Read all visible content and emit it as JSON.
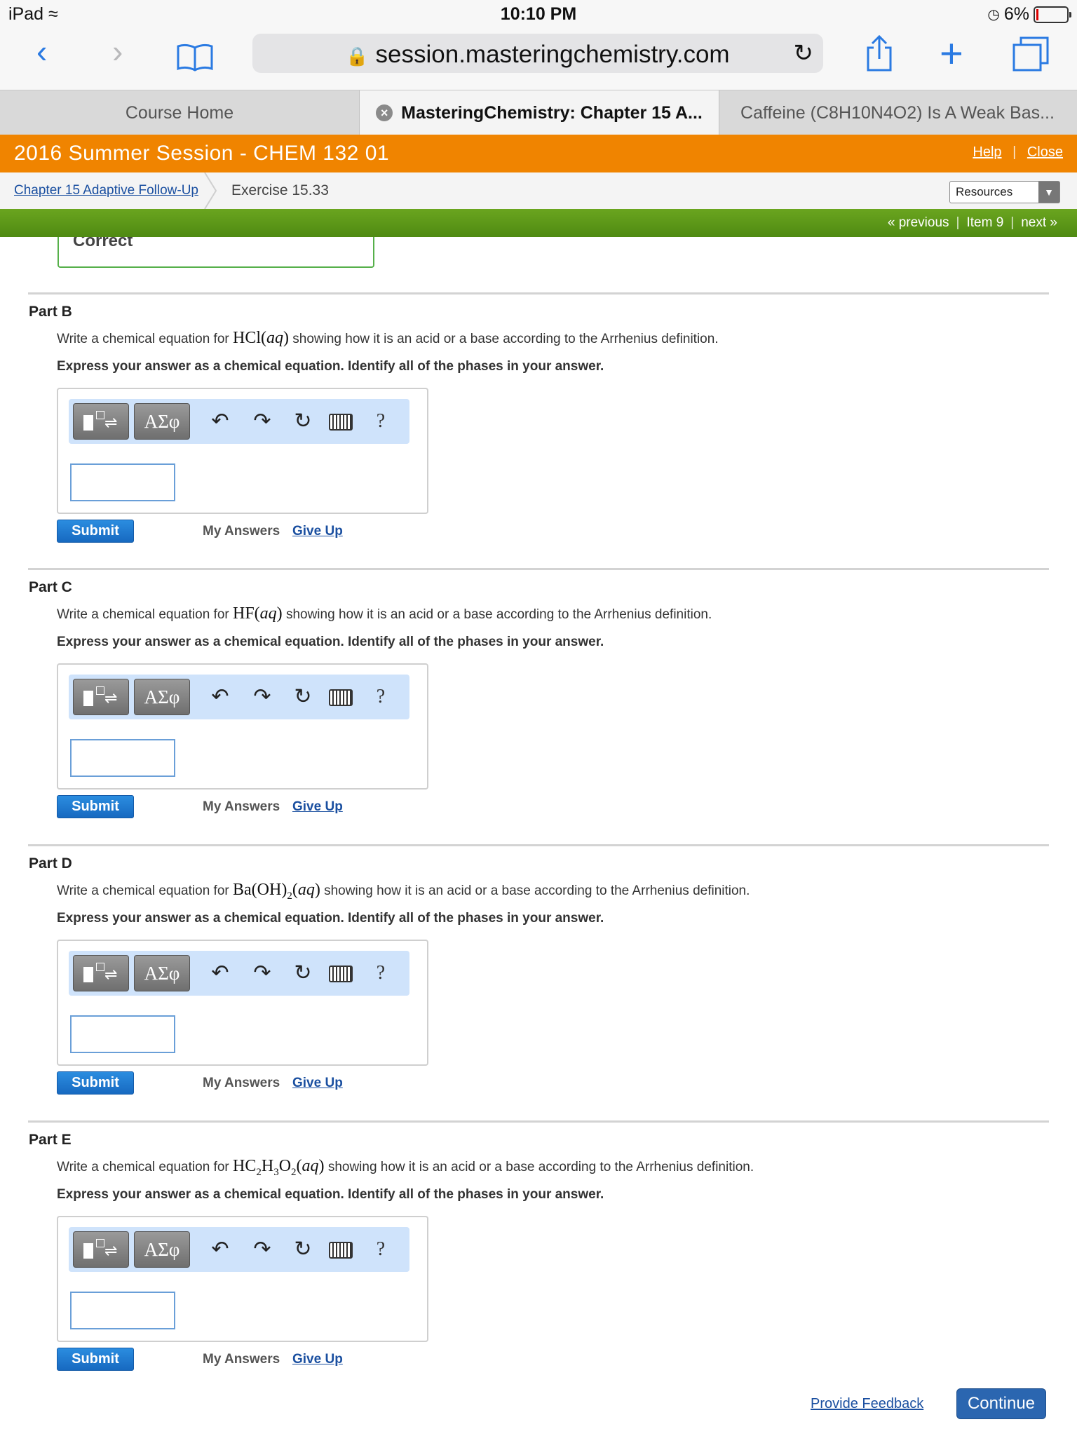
{
  "status": {
    "device": "iPad",
    "time": "10:10 PM",
    "battery": "6%"
  },
  "browser": {
    "url": "session.masteringchemistry.com"
  },
  "tabs": [
    {
      "label": "Course Home"
    },
    {
      "label": "MasteringChemistry: Chapter 15 A..."
    },
    {
      "label": "Caffeine (C8H10N4O2) Is A Weak Bas..."
    }
  ],
  "course": {
    "title": "2016 Summer Session - CHEM 132 01",
    "help": "Help",
    "close": "Close"
  },
  "breadcrumb": {
    "assignment": "Chapter 15 Adaptive Follow-Up",
    "exercise": "Exercise 15.33",
    "resources": "Resources"
  },
  "pager": {
    "previous": "« previous",
    "item": "Item 9",
    "next": "next »"
  },
  "correct_label": "Correct",
  "common": {
    "instruction": "Express your answer as a chemical equation. Identify all of the phases in your answer.",
    "prefix": "Write a chemical equation for",
    "suffix": "showing how it is an acid or a base according to the Arrhenius definition.",
    "greek": "ΑΣφ",
    "help_glyph": "?",
    "submit": "Submit",
    "my_answers": "My Answers",
    "give_up": "Give Up"
  },
  "parts": {
    "b": {
      "title": "Part B"
    },
    "c": {
      "title": "Part C"
    },
    "d": {
      "title": "Part D"
    },
    "e": {
      "title": "Part E"
    }
  },
  "footer": {
    "feedback": "Provide Feedback",
    "continue": "Continue"
  }
}
